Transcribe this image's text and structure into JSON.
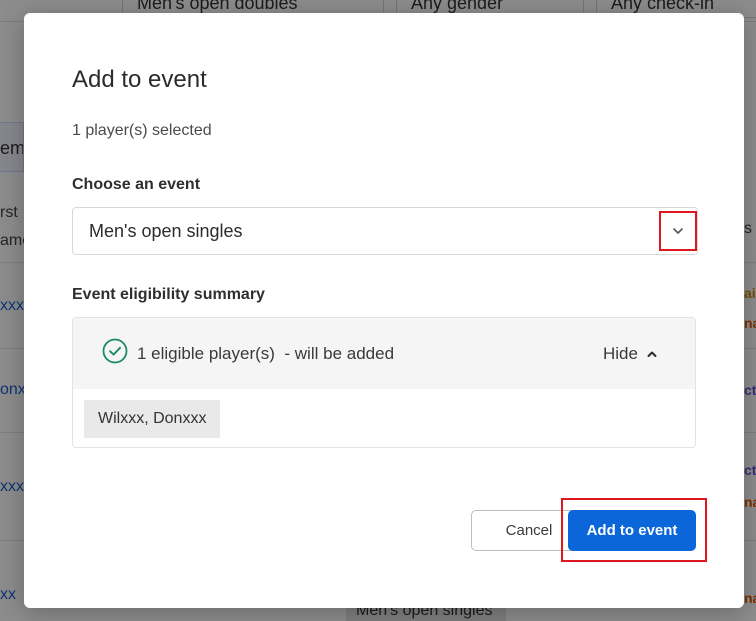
{
  "background": {
    "filters": [
      "Men's open doubles",
      "Any gender",
      "Any check-in"
    ],
    "left_tab": "ema",
    "left_texts": [
      "rst",
      "ame"
    ],
    "left_links": [
      "xxx",
      "onx",
      "xxx",
      "xx"
    ],
    "right_cells": [
      {
        "text": "ai",
        "color": "#d98a00"
      },
      {
        "text": "na",
        "color": "#e05a00"
      },
      {
        "text": "ct",
        "color": "#6b4fd6"
      },
      {
        "text": "ct",
        "color": "#6b4fd6"
      },
      {
        "text": "na",
        "color": "#e05a00"
      },
      {
        "text": "na",
        "color": "#e05a00"
      }
    ],
    "right_s": "s",
    "bottom_pill": "Men's open singles"
  },
  "modal": {
    "title": "Add to event",
    "selected_count": "1 player(s) selected",
    "choose_label": "Choose an event",
    "select": {
      "value": "Men's open singles",
      "icon": "chevron-down-icon"
    },
    "eligibility": {
      "label": "Event eligibility summary",
      "status_icon": "check-circle-icon",
      "status_color": "#1a8a6a",
      "text": "1 eligible player(s)  - will be added",
      "toggle_label": "Hide",
      "toggle_icon": "chevron-up-icon",
      "players": [
        "Wilxxx, Donxxx"
      ]
    },
    "buttons": {
      "cancel": "Cancel",
      "submit": "Add to event"
    },
    "colors": {
      "primary": "#0a66d9",
      "highlight": "#e0171f"
    }
  }
}
